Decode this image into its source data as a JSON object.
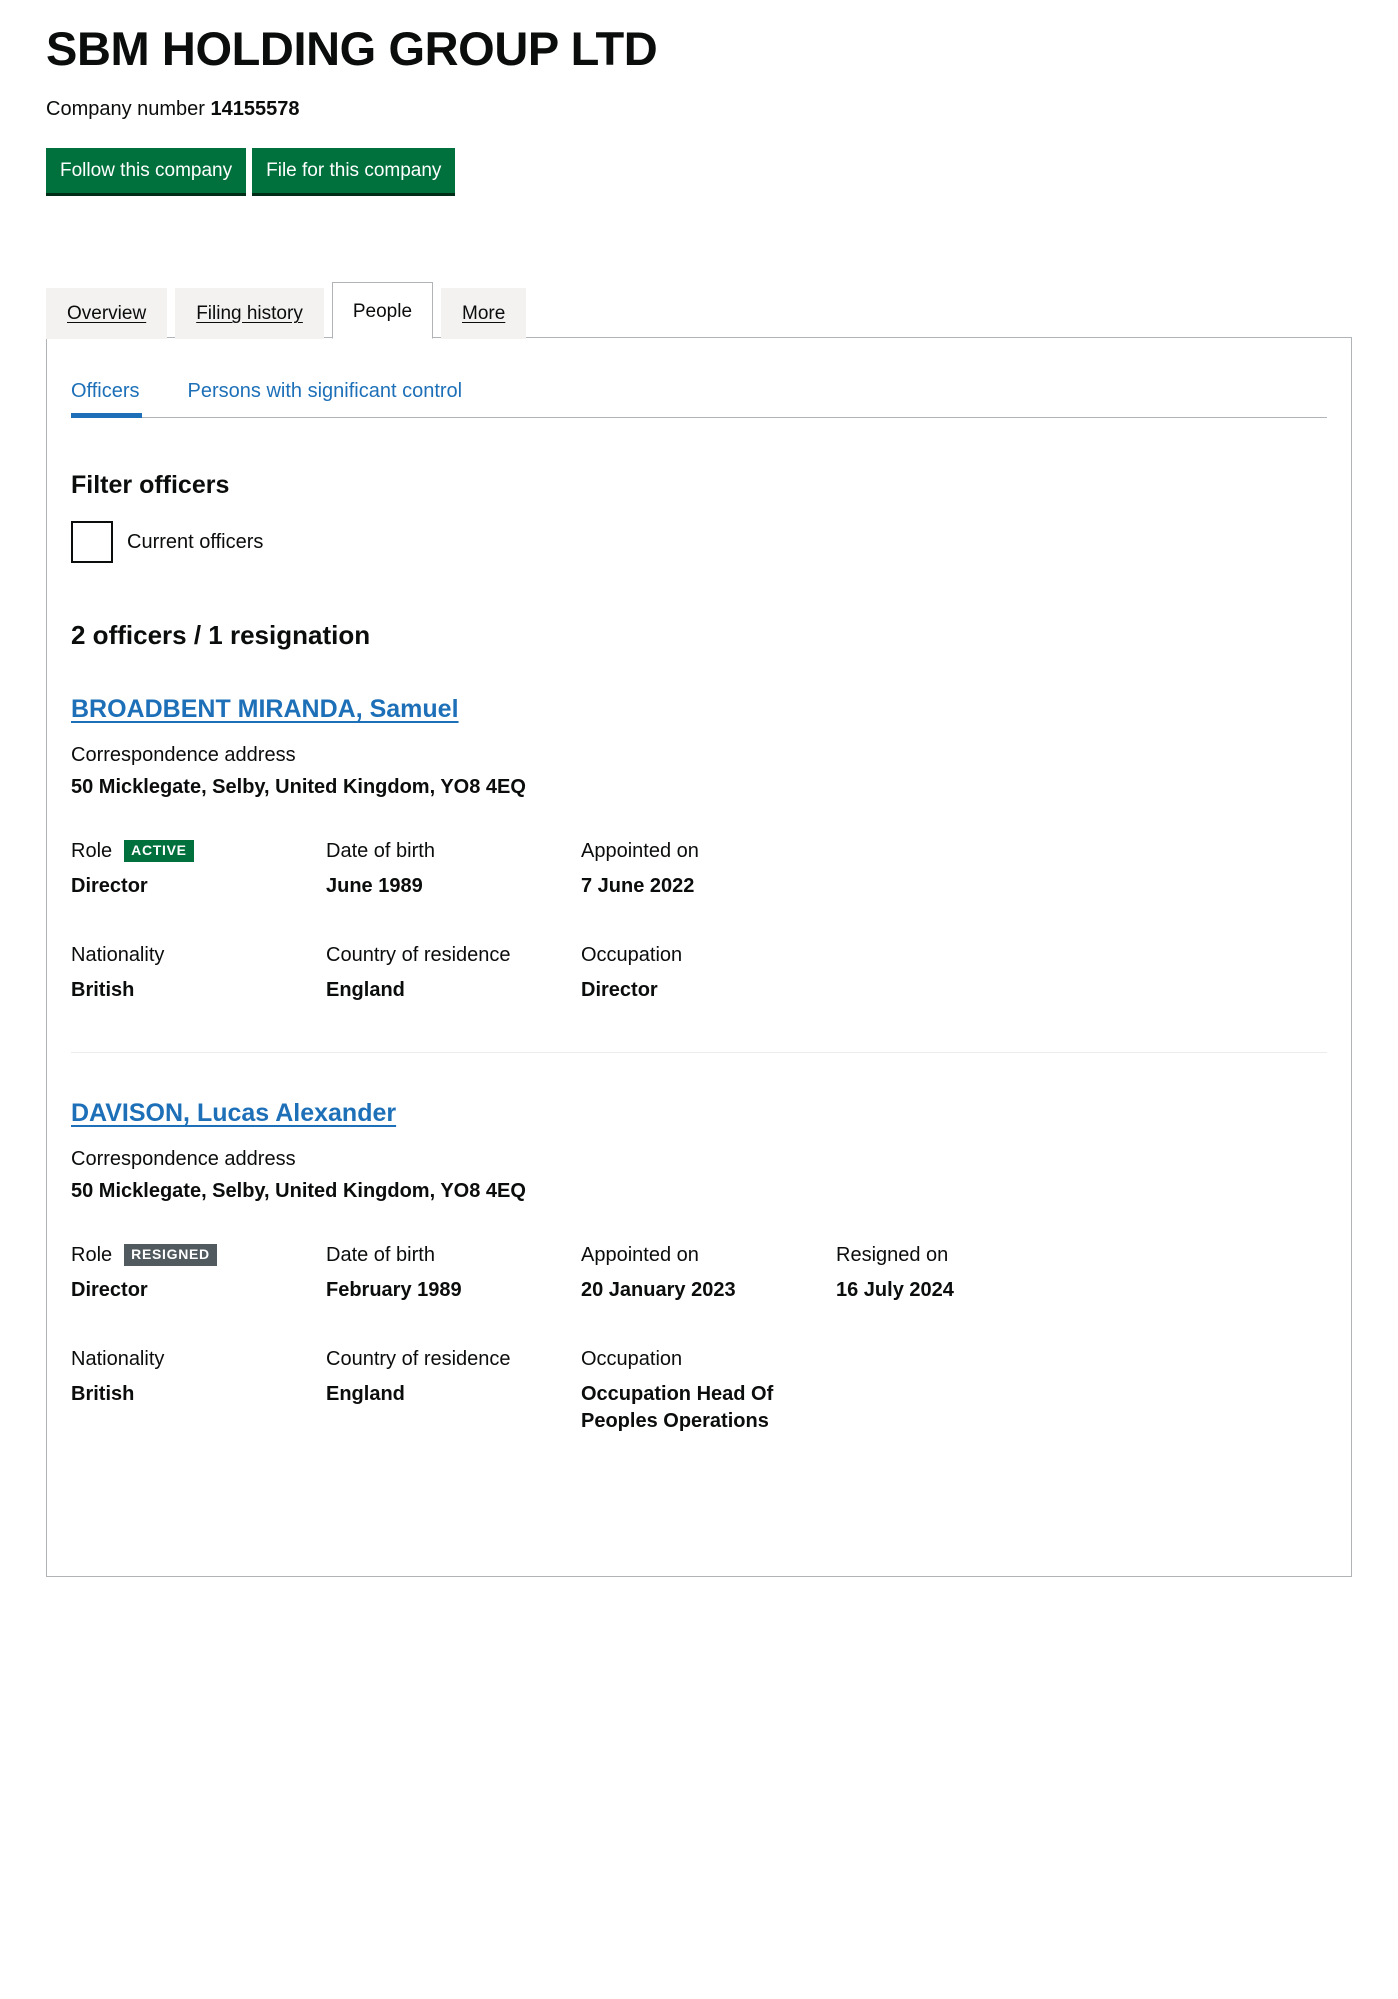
{
  "company": {
    "title": "SBM HOLDING GROUP LTD",
    "number_label": "Company number",
    "number": "14155578"
  },
  "actions": {
    "follow_label": "Follow this company",
    "file_label": "File for this company"
  },
  "tabs": [
    {
      "label": "Overview",
      "selected": false
    },
    {
      "label": "Filing history",
      "selected": false
    },
    {
      "label": "People",
      "selected": true
    },
    {
      "label": "More",
      "selected": false
    }
  ],
  "subtabs": [
    {
      "label": "Officers",
      "active": true
    },
    {
      "label": "Persons with significant control",
      "active": false
    }
  ],
  "filter": {
    "heading": "Filter officers",
    "checkbox_label": "Current officers",
    "checked": false
  },
  "summary": "2 officers / 1 resignation",
  "labels": {
    "correspondence_address": "Correspondence address",
    "role": "Role",
    "date_of_birth": "Date of birth",
    "appointed_on": "Appointed on",
    "resigned_on": "Resigned on",
    "nationality": "Nationality",
    "country_of_residence": "Country of residence",
    "occupation": "Occupation"
  },
  "officers": [
    {
      "name": "BROADBENT MIRANDA, Samuel",
      "address": "50 Micklegate, Selby, United Kingdom, YO8 4EQ",
      "status_badge": "ACTIVE",
      "status_type": "active",
      "role": "Director",
      "date_of_birth": "June 1989",
      "appointed_on": "7 June 2022",
      "resigned_on": "",
      "nationality": "British",
      "country_of_residence": "England",
      "occupation": "Director",
      "has_resigned_column": false
    },
    {
      "name": "DAVISON, Lucas Alexander",
      "address": "50 Micklegate, Selby, United Kingdom, YO8 4EQ",
      "status_badge": "RESIGNED",
      "status_type": "resigned",
      "role": "Director",
      "date_of_birth": "February 1989",
      "appointed_on": "20 January 2023",
      "resigned_on": "16 July 2024",
      "nationality": "British",
      "country_of_residence": "England",
      "occupation": "Occupation Head Of Peoples Operations",
      "has_resigned_column": true
    }
  ],
  "colors": {
    "green": "#00703c",
    "link_blue": "#1d70b8",
    "resigned_grey": "#505a5f",
    "border_grey": "#b1b4b6",
    "tab_grey": "#f3f2f1"
  }
}
